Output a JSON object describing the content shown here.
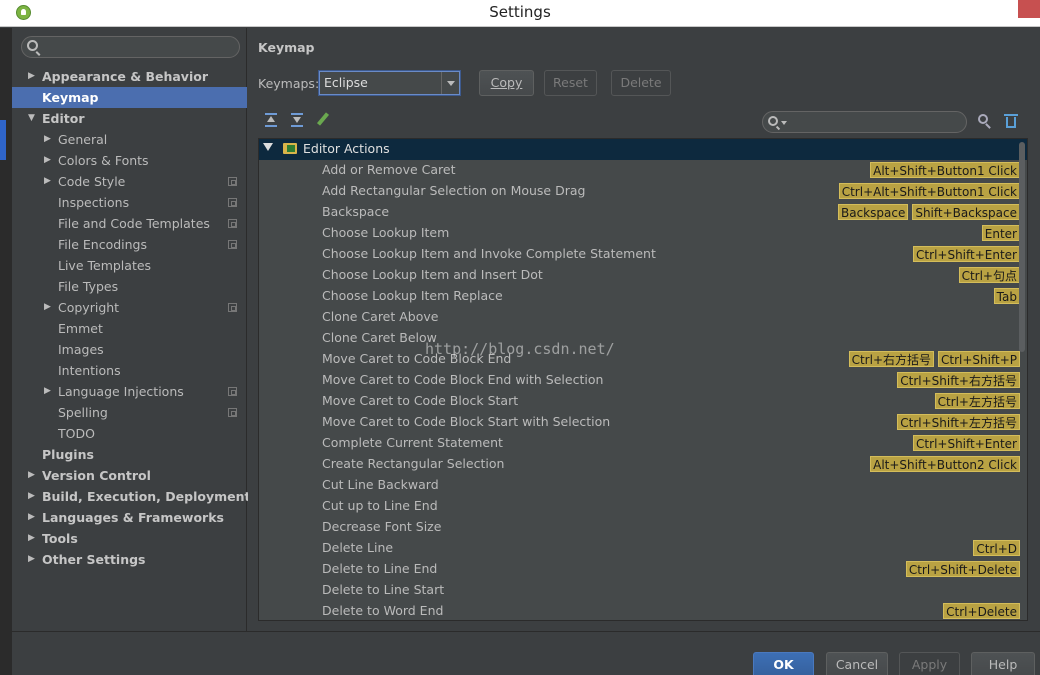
{
  "window": {
    "title": "Settings"
  },
  "search": {
    "placeholder": ""
  },
  "sidebar": {
    "items": [
      {
        "label": "Appearance & Behavior",
        "arrow": "right",
        "bold": true,
        "indent": 0,
        "cfg": false,
        "selected": false
      },
      {
        "label": "Keymap",
        "arrow": "",
        "bold": true,
        "indent": 0,
        "cfg": false,
        "selected": true
      },
      {
        "label": "Editor",
        "arrow": "down",
        "bold": true,
        "indent": 0,
        "cfg": false,
        "selected": false
      },
      {
        "label": "General",
        "arrow": "right",
        "bold": false,
        "indent": 1,
        "cfg": false,
        "selected": false
      },
      {
        "label": "Colors & Fonts",
        "arrow": "right",
        "bold": false,
        "indent": 1,
        "cfg": false,
        "selected": false
      },
      {
        "label": "Code Style",
        "arrow": "right",
        "bold": false,
        "indent": 1,
        "cfg": true,
        "selected": false
      },
      {
        "label": "Inspections",
        "arrow": "",
        "bold": false,
        "indent": 1,
        "cfg": true,
        "selected": false
      },
      {
        "label": "File and Code Templates",
        "arrow": "",
        "bold": false,
        "indent": 1,
        "cfg": true,
        "selected": false
      },
      {
        "label": "File Encodings",
        "arrow": "",
        "bold": false,
        "indent": 1,
        "cfg": true,
        "selected": false
      },
      {
        "label": "Live Templates",
        "arrow": "",
        "bold": false,
        "indent": 1,
        "cfg": false,
        "selected": false
      },
      {
        "label": "File Types",
        "arrow": "",
        "bold": false,
        "indent": 1,
        "cfg": false,
        "selected": false
      },
      {
        "label": "Copyright",
        "arrow": "right",
        "bold": false,
        "indent": 1,
        "cfg": true,
        "selected": false
      },
      {
        "label": "Emmet",
        "arrow": "",
        "bold": false,
        "indent": 1,
        "cfg": false,
        "selected": false
      },
      {
        "label": "Images",
        "arrow": "",
        "bold": false,
        "indent": 1,
        "cfg": false,
        "selected": false
      },
      {
        "label": "Intentions",
        "arrow": "",
        "bold": false,
        "indent": 1,
        "cfg": false,
        "selected": false
      },
      {
        "label": "Language Injections",
        "arrow": "right",
        "bold": false,
        "indent": 1,
        "cfg": true,
        "selected": false
      },
      {
        "label": "Spelling",
        "arrow": "",
        "bold": false,
        "indent": 1,
        "cfg": true,
        "selected": false
      },
      {
        "label": "TODO",
        "arrow": "",
        "bold": false,
        "indent": 1,
        "cfg": false,
        "selected": false
      },
      {
        "label": "Plugins",
        "arrow": "",
        "bold": true,
        "indent": 0,
        "cfg": false,
        "selected": false
      },
      {
        "label": "Version Control",
        "arrow": "right",
        "bold": true,
        "indent": 0,
        "cfg": false,
        "selected": false
      },
      {
        "label": "Build, Execution, Deployment",
        "arrow": "right",
        "bold": true,
        "indent": 0,
        "cfg": false,
        "selected": false
      },
      {
        "label": "Languages & Frameworks",
        "arrow": "right",
        "bold": true,
        "indent": 0,
        "cfg": false,
        "selected": false
      },
      {
        "label": "Tools",
        "arrow": "right",
        "bold": true,
        "indent": 0,
        "cfg": false,
        "selected": false
      },
      {
        "label": "Other Settings",
        "arrow": "right",
        "bold": true,
        "indent": 0,
        "cfg": false,
        "selected": false
      }
    ]
  },
  "main": {
    "heading": "Keymap",
    "keymaps_label": "Keymaps:",
    "keymap_value": "Eclipse",
    "copy_label": "Copy",
    "reset_label": "Reset",
    "delete_label": "Delete",
    "filter_placeholder": ""
  },
  "actions": {
    "group": "Editor Actions",
    "rows": [
      {
        "name": "Add or Remove Caret",
        "keys": [
          "Alt+Shift+Button1 Click"
        ]
      },
      {
        "name": "Add Rectangular Selection on Mouse Drag",
        "keys": [
          "Ctrl+Alt+Shift+Button1 Click"
        ]
      },
      {
        "name": "Backspace",
        "keys": [
          "Backspace",
          "Shift+Backspace"
        ]
      },
      {
        "name": "Choose Lookup Item",
        "keys": [
          "Enter"
        ]
      },
      {
        "name": "Choose Lookup Item and Invoke Complete Statement",
        "keys": [
          "Ctrl+Shift+Enter"
        ]
      },
      {
        "name": "Choose Lookup Item and Insert Dot",
        "keys": [
          "Ctrl+句点"
        ]
      },
      {
        "name": "Choose Lookup Item Replace",
        "keys": [
          "Tab"
        ]
      },
      {
        "name": "Clone Caret Above",
        "keys": []
      },
      {
        "name": "Clone Caret Below",
        "keys": []
      },
      {
        "name": "Move Caret to Code Block End",
        "keys": [
          "Ctrl+右方括号",
          "Ctrl+Shift+P"
        ]
      },
      {
        "name": "Move Caret to Code Block End with Selection",
        "keys": [
          "Ctrl+Shift+右方括号"
        ]
      },
      {
        "name": "Move Caret to Code Block Start",
        "keys": [
          "Ctrl+左方括号"
        ]
      },
      {
        "name": "Move Caret to Code Block Start with Selection",
        "keys": [
          "Ctrl+Shift+左方括号"
        ]
      },
      {
        "name": "Complete Current Statement",
        "keys": [
          "Ctrl+Shift+Enter"
        ]
      },
      {
        "name": "Create Rectangular Selection",
        "keys": [
          "Alt+Shift+Button2 Click"
        ]
      },
      {
        "name": "Cut Line Backward",
        "keys": []
      },
      {
        "name": "Cut up to Line End",
        "keys": []
      },
      {
        "name": "Decrease Font Size",
        "keys": []
      },
      {
        "name": "Delete Line",
        "keys": [
          "Ctrl+D"
        ]
      },
      {
        "name": "Delete to Line End",
        "keys": [
          "Ctrl+Shift+Delete"
        ]
      },
      {
        "name": "Delete to Line Start",
        "keys": []
      },
      {
        "name": "Delete to Word End",
        "keys": [
          "Ctrl+Delete"
        ]
      }
    ]
  },
  "watermark": "http://blog.csdn.net/",
  "footer": {
    "ok": "OK",
    "cancel": "Cancel",
    "apply": "Apply",
    "help": "Help"
  }
}
